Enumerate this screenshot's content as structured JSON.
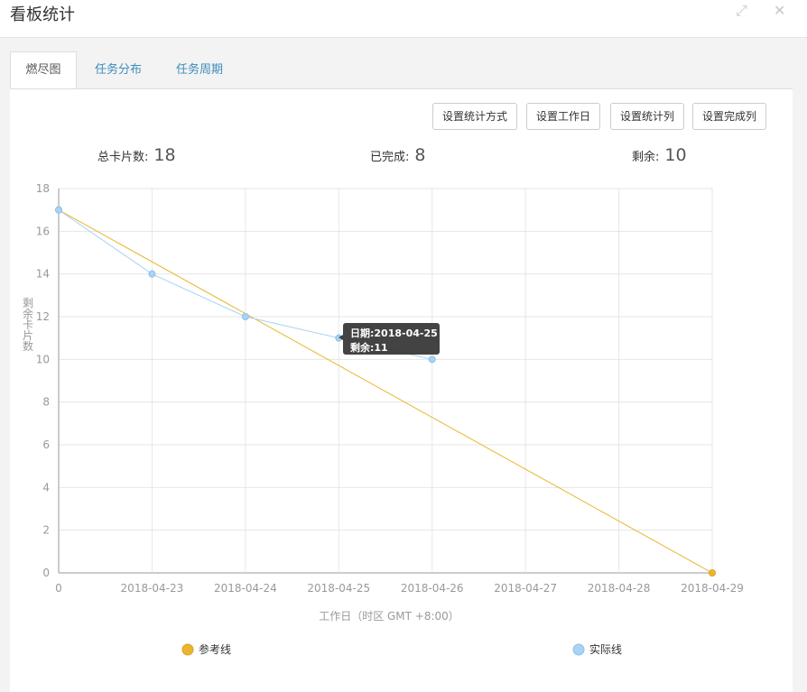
{
  "window": {
    "title": "看板统计",
    "expand_icon": "expand-icon",
    "close_icon": "close-icon"
  },
  "tabs": [
    {
      "label": "燃尽图",
      "active": true
    },
    {
      "label": "任务分布",
      "active": false
    },
    {
      "label": "任务周期",
      "active": false
    }
  ],
  "toolbar": {
    "set_stat_method": "设置统计方式",
    "set_workday": "设置工作日",
    "set_stat_column": "设置统计列",
    "set_done_column": "设置完成列"
  },
  "stats": {
    "total_label": "总卡片数:",
    "total_value": "18",
    "done_label": "已完成:",
    "done_value": "8",
    "remaining_label": "剩余:",
    "remaining_value": "10"
  },
  "tooltip": {
    "date_line": "日期:2018-04-25",
    "remaining_line": "剩余:11"
  },
  "chart_data": {
    "type": "line",
    "xlabel": "工作日（时区 GMT +8:00）",
    "ylabel": "剩余卡片数",
    "ylim": [
      0,
      18
    ],
    "yticks": [
      0,
      2,
      4,
      6,
      8,
      10,
      12,
      14,
      16,
      18
    ],
    "categories": [
      "0",
      "2018-04-23",
      "2018-04-24",
      "2018-04-25",
      "2018-04-26",
      "2018-04-27",
      "2018-04-28",
      "2018-04-29"
    ],
    "grid": true,
    "legend_position": "bottom",
    "series": [
      {
        "name": "参考线",
        "color": "#e8b72f",
        "points": [
          [
            0,
            17
          ],
          [
            7,
            0
          ]
        ]
      },
      {
        "name": "实际线",
        "color": "#a9d3f2",
        "points": [
          [
            0,
            17
          ],
          [
            1,
            14
          ],
          [
            2,
            12
          ],
          [
            3,
            11
          ],
          [
            4,
            10
          ]
        ]
      }
    ]
  }
}
